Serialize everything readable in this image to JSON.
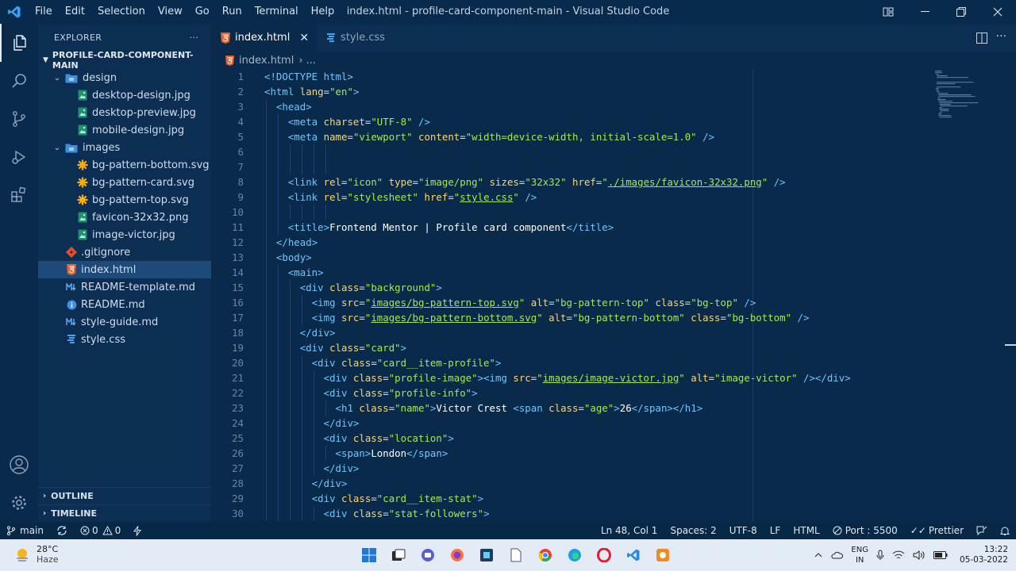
{
  "window": {
    "title": "index.html - profile-card-component-main - Visual Studio Code",
    "menu": [
      "File",
      "Edit",
      "Selection",
      "View",
      "Go",
      "Run",
      "Terminal",
      "Help"
    ]
  },
  "sidebar": {
    "header": "EXPLORER",
    "more": "···",
    "root": "PROFILE-CARD-COMPONENT-MAIN",
    "tree": [
      {
        "label": "design",
        "type": "folder",
        "depth": 1
      },
      {
        "label": "desktop-design.jpg",
        "type": "image",
        "depth": 2
      },
      {
        "label": "desktop-preview.jpg",
        "type": "image",
        "depth": 2
      },
      {
        "label": "mobile-design.jpg",
        "type": "image",
        "depth": 2
      },
      {
        "label": "images",
        "type": "folder",
        "depth": 1
      },
      {
        "label": "bg-pattern-bottom.svg",
        "type": "svg",
        "depth": 2
      },
      {
        "label": "bg-pattern-card.svg",
        "type": "svg",
        "depth": 2
      },
      {
        "label": "bg-pattern-top.svg",
        "type": "svg",
        "depth": 2
      },
      {
        "label": "favicon-32x32.png",
        "type": "image",
        "depth": 2
      },
      {
        "label": "image-victor.jpg",
        "type": "image",
        "depth": 2
      },
      {
        "label": ".gitignore",
        "type": "git",
        "depth": 1
      },
      {
        "label": "index.html",
        "type": "html",
        "depth": 1,
        "selected": true
      },
      {
        "label": "README-template.md",
        "type": "md",
        "depth": 1
      },
      {
        "label": "README.md",
        "type": "info",
        "depth": 1
      },
      {
        "label": "style-guide.md",
        "type": "md",
        "depth": 1
      },
      {
        "label": "style.css",
        "type": "css",
        "depth": 1
      }
    ],
    "outline": "OUTLINE",
    "timeline": "TIMELINE"
  },
  "tabs": [
    {
      "label": "index.html",
      "active": true,
      "close": "✕"
    },
    {
      "label": "style.css",
      "active": false
    }
  ],
  "breadcrumb": {
    "file": "index.html",
    "rest": "›  ..."
  },
  "code": [
    "<!DOCTYPE html>",
    "<html lang=\"en\">",
    "  <head>",
    "    <meta charset=\"UTF-8\" />",
    "    <meta name=\"viewport\" content=\"width=device-width, initial-scale=1.0\" />",
    "",
    "",
    "    <link rel=\"icon\" type=\"image/png\" sizes=\"32x32\" href=\"./images/favicon-32x32.png\" />",
    "    <link rel=\"stylesheet\" href=\"style.css\" />",
    "",
    "    <title>Frontend Mentor | Profile card component</title>",
    "  </head>",
    "  <body>",
    "    <main>",
    "      <div class=\"background\">",
    "        <img src=\"images/bg-pattern-top.svg\" alt=\"bg-pattern-top\" class=\"bg-top\" />",
    "        <img src=\"images/bg-pattern-bottom.svg\" alt=\"bg-pattern-bottom\" class=\"bg-bottom\" />",
    "      </div>",
    "      <div class=\"card\">",
    "        <div class=\"card__item-profile\">",
    "          <div class=\"profile-image\"><img src=\"images/image-victor.jpg\" alt=\"image-victor\" /></div>",
    "          <div class=\"profile-info\">",
    "            <h1 class=\"name\">Victor Crest <span class=\"age\">26</span></h1>",
    "          </div>",
    "          <div class=\"location\">",
    "            <span>London</span>",
    "          </div>",
    "        </div>",
    "        <div class=\"card__item-stat\">",
    "          <div class=\"stat-followers\">"
  ],
  "statusbar": {
    "branch": "main",
    "errors": "0",
    "warnings": "0",
    "position": "Ln 48, Col 1",
    "spaces": "Spaces: 2",
    "encoding": "UTF-8",
    "eol": "LF",
    "language": "HTML",
    "port": "Port : 5500",
    "prettier": "Prettier"
  },
  "taskbar": {
    "temperature": "28°C",
    "weather": "Haze",
    "lang1": "ENG",
    "lang2": "IN",
    "time": "13:22",
    "date": "05-03-2022"
  },
  "colors": {
    "editor_bg": "#0a2a4c",
    "tag": "#6ec6ff",
    "attribute": "#f7d774",
    "string": "#a5e84f",
    "selection": "#1d4a78"
  }
}
